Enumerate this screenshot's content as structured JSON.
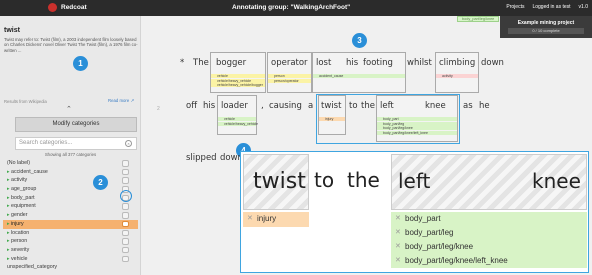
{
  "app": {
    "brand": "Redcoat",
    "title": "Annotating group: \"WalkingArchFoot\"",
    "nav": [
      "Projects",
      "Logged in as test",
      "v1.0"
    ]
  },
  "project_panel": {
    "title": "Example mining project",
    "progress": "0 / 10 complete",
    "pill": "body_part/leg/knee"
  },
  "sidebar": {
    "doc_title": "twist",
    "doc_text": "Twist may refer to: Twist (film), a 2003 independent film loosely based on Charles Dickens' novel Oliver Twist The Twist (film), a 1976 film co-written ...",
    "wiki_note": "Results from Wikipedia",
    "read_more": "Read more",
    "modify_button": "Modify categories",
    "search_placeholder": "Search categories...",
    "showing": "Showing all 377 categories",
    "categories": [
      {
        "label": "(No label)",
        "check": ""
      },
      {
        "label": "accident_cause",
        "check": "▸"
      },
      {
        "label": "activity",
        "check": "▸"
      },
      {
        "label": "age_group",
        "check": "▸"
      },
      {
        "label": "body_part",
        "check": "▸"
      },
      {
        "label": "equipment",
        "check": "▸"
      },
      {
        "label": "gender",
        "check": "▸"
      },
      {
        "label": "injury",
        "check": "▸"
      },
      {
        "label": "location",
        "check": "▸"
      },
      {
        "label": "person",
        "check": "▸"
      },
      {
        "label": "severity",
        "check": "▸"
      },
      {
        "label": "vehicle",
        "check": "▸"
      },
      {
        "label": "unspecified_category",
        "check": ""
      }
    ]
  },
  "badges": [
    "1",
    "2",
    "3",
    "4"
  ],
  "doc": {
    "row_number": "2",
    "line1": [
      "*",
      "The",
      "bogger",
      "operator",
      "lost",
      "his",
      "footing",
      "whilst",
      "climbing",
      "down"
    ],
    "line2": [
      "off",
      "his",
      "loader",
      ",",
      "causing",
      "a",
      "twist",
      "to",
      "the",
      "left",
      "knee",
      "as",
      "he"
    ],
    "line3": [
      "slipped",
      "down"
    ],
    "labels": {
      "bogger": [
        "vehicle",
        "vehicle/heavy_vehicle",
        "vehicle/heavy_vehicle/bogger"
      ],
      "operator": [
        "person",
        "person/operator"
      ],
      "lost_footing": [
        "accident_cause"
      ],
      "climbing": [
        "activity"
      ],
      "loader": [
        "vehicle",
        "vehicle/heavy_vehicle"
      ],
      "twist": [
        "injury"
      ],
      "left_knee": [
        "body_part",
        "body_part/leg",
        "body_part/leg/knee",
        "body_part/leg/knee/left_knee"
      ]
    }
  },
  "zoom": {
    "tokens": [
      "twist",
      "to",
      "the",
      "left",
      "knee"
    ],
    "injury_label": "injury",
    "knee_labels": [
      "body_part",
      "body_part/leg",
      "body_part/leg/knee",
      "body_part/leg/knee/left_knee"
    ]
  }
}
